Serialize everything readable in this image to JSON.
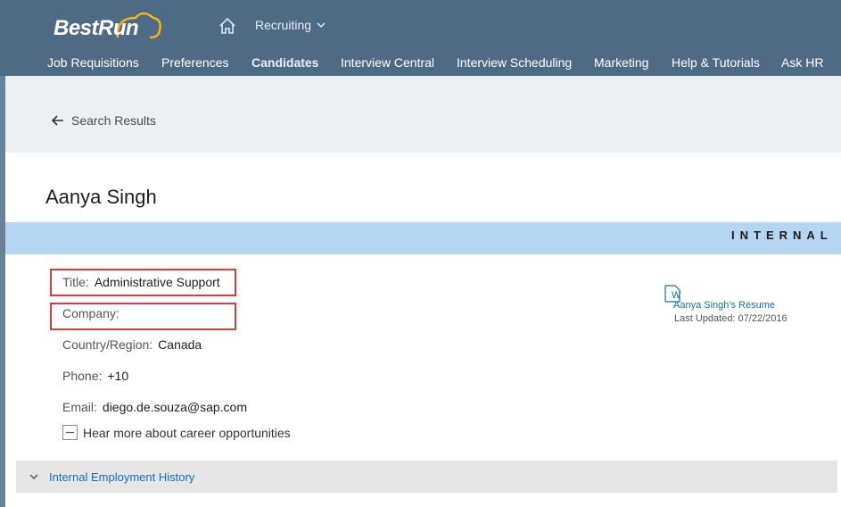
{
  "header": {
    "logo_text": "BestRun",
    "module": "Recruiting",
    "nav": [
      {
        "label": "Job Requisitions"
      },
      {
        "label": "Preferences"
      },
      {
        "label": "Candidates"
      },
      {
        "label": "Interview Central"
      },
      {
        "label": "Interview Scheduling"
      },
      {
        "label": "Marketing"
      },
      {
        "label": "Help & Tutorials"
      },
      {
        "label": "Ask HR"
      }
    ]
  },
  "breadcrumb": {
    "back_label": "Search Results"
  },
  "candidate": {
    "name": "Aanya Singh",
    "band_label": "INTERNAL C",
    "fields": {
      "title_label": "Title:",
      "title_value": "Administrative Support",
      "company_label": "Company:",
      "company_value": "",
      "country_label": "Country/Region:",
      "country_value": "Canada",
      "phone_label": "Phone:",
      "phone_value": "+10",
      "email_label": "Email:",
      "email_value": "diego.de.souza@sap.com"
    },
    "opt_in_label": "Hear more about career opportunities",
    "resume": {
      "link": "Aanya Singh's Resume",
      "updated": "Last Updated: 07/22/2016",
      "icon_letter": "W"
    }
  },
  "section": {
    "history_label": "Internal Employment History"
  },
  "colors": {
    "header_bg": "#4f6b83",
    "accent_band": "#b5d5f5",
    "highlight": "#e0383e",
    "link": "#1b6bb3"
  }
}
